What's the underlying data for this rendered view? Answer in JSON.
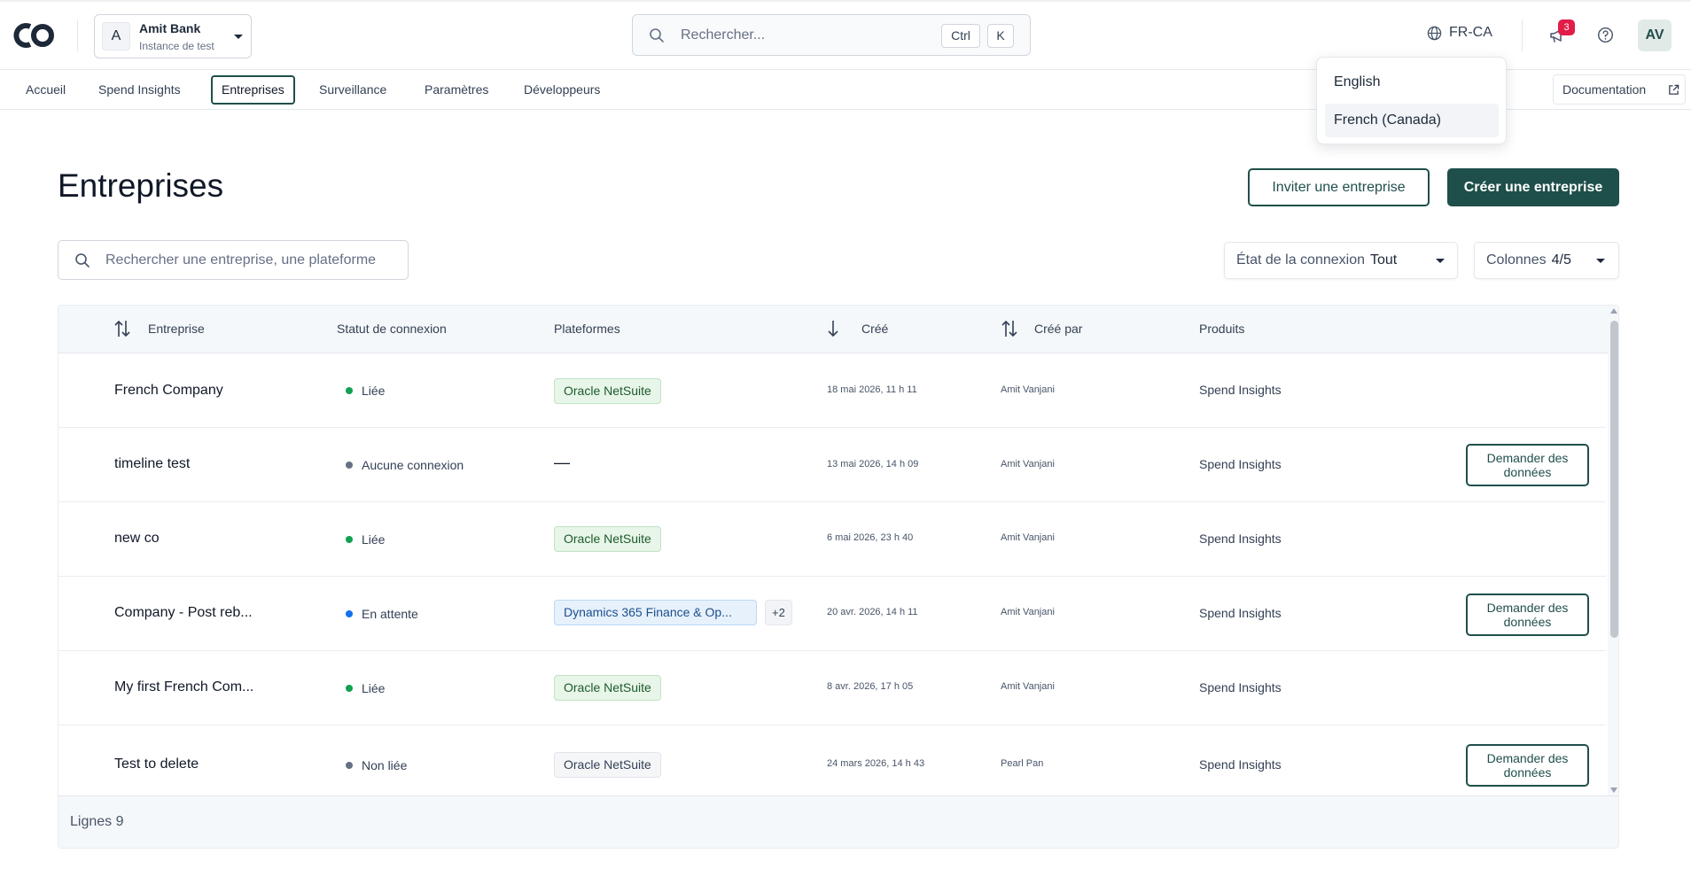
{
  "header": {
    "org": {
      "initial": "A",
      "name": "Amit Bank",
      "subtitle": "Instance de test"
    },
    "search": {
      "placeholder": "Rechercher...",
      "kbd1": "Ctrl",
      "kbd2": "K"
    },
    "language": "FR-CA",
    "notifications_count": "3",
    "user_initials": "AV"
  },
  "nav": {
    "tabs": [
      {
        "label": "Accueil"
      },
      {
        "label": "Spend Insights"
      },
      {
        "label": "Entreprises",
        "active": true
      },
      {
        "label": "Surveillance"
      },
      {
        "label": "Paramètres"
      },
      {
        "label": "Développeurs"
      }
    ],
    "documentation": "Documentation"
  },
  "language_menu": {
    "options": [
      {
        "label": "English"
      },
      {
        "label": "French (Canada)",
        "selected": true
      }
    ]
  },
  "page": {
    "title": "Entreprises",
    "invite_label": "Inviter une entreprise",
    "create_label": "Créer une entreprise",
    "table_search_placeholder": "Rechercher une entreprise, une plateforme",
    "filters": {
      "connection_label": "État de la connexion",
      "connection_value": "Tout",
      "columns_label": "Colonnes",
      "columns_value": "4/5"
    }
  },
  "table": {
    "columns": {
      "company": "Entreprise",
      "status": "Statut de connexion",
      "platforms": "Plateformes",
      "created": "Créé",
      "created_by": "Créé par",
      "products": "Produits"
    },
    "rows": [
      {
        "name": "French Company",
        "status": "Liée",
        "status_color": "#12a150",
        "platform": "Oracle NetSuite",
        "platform_style": "green",
        "created": "18 mai 2026, 11 h 11",
        "by": "Amit Vanjani",
        "product": "Spend Insights",
        "action": ""
      },
      {
        "name": "timeline test",
        "status": "Aucune connexion",
        "status_color": "#667085",
        "platform": "—",
        "platform_style": "none",
        "created": "13 mai 2026, 14 h 09",
        "by": "Amit Vanjani",
        "product": "Spend Insights",
        "action": "Demander des données"
      },
      {
        "name": "new co",
        "status": "Liée",
        "status_color": "#12a150",
        "platform": "Oracle NetSuite",
        "platform_style": "green",
        "created": "6 mai 2026, 23 h 40",
        "by": "Amit Vanjani",
        "product": "Spend Insights",
        "action": ""
      },
      {
        "name": "Company - Post reb...",
        "status": "En attente",
        "status_color": "#1570ef",
        "platform": "Dynamics 365 Finance & Op...",
        "platform_style": "blue",
        "more": "+2",
        "created": "20 avr. 2026, 14 h 11",
        "by": "Amit Vanjani",
        "product": "Spend Insights",
        "action": "Demander des données"
      },
      {
        "name": "My first French Com...",
        "status": "Liée",
        "status_color": "#12a150",
        "platform": "Oracle NetSuite",
        "platform_style": "green",
        "created": "8 avr. 2026, 17 h 05",
        "by": "Amit Vanjani",
        "product": "Spend Insights",
        "action": ""
      },
      {
        "name": "Test to delete",
        "status": "Non liée",
        "status_color": "#667085",
        "platform": "Oracle NetSuite",
        "platform_style": "grey",
        "created": "24 mars 2026, 14 h 43",
        "by": "Pearl Pan",
        "product": "Spend Insights",
        "action": "Demander des données"
      }
    ],
    "footer": "Lignes 9"
  },
  "colors": {
    "accent": "#1f4f4b",
    "badge": "#e11d48"
  }
}
